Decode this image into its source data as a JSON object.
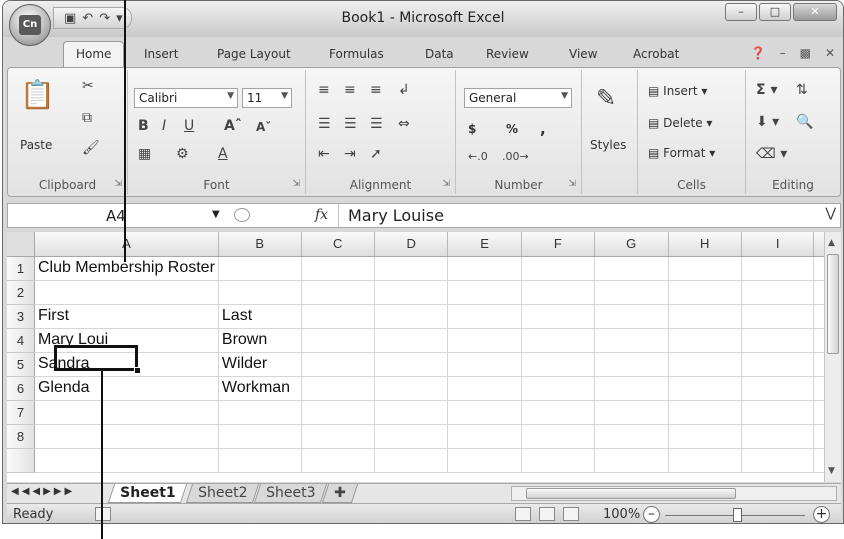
{
  "window": {
    "title": "Book1 - Microsoft Excel",
    "office_logo": "Cn"
  },
  "quick_access": [
    "save-icon",
    "undo-icon",
    "redo-icon",
    "customize-icon"
  ],
  "tabs": [
    "Home",
    "Insert",
    "Page Layout",
    "Formulas",
    "Data",
    "Review",
    "View",
    "Acrobat"
  ],
  "ribbon": {
    "clipboard": {
      "label": "Clipboard",
      "paste": "Paste"
    },
    "font": {
      "label": "Font",
      "name": "Calibri",
      "size": "11"
    },
    "alignment": {
      "label": "Alignment"
    },
    "number": {
      "label": "Number",
      "format": "General",
      "currency": "$",
      "percent": "%",
      "comma": ","
    },
    "styles": {
      "label": "Styles"
    },
    "cells": {
      "label": "Cells",
      "insert": "Insert",
      "delete": "Delete",
      "format": "Format"
    },
    "editing": {
      "label": "Editing"
    }
  },
  "formula_bar": {
    "name_box": "A4",
    "fx": "fx",
    "content": "Mary Louise"
  },
  "grid": {
    "columns": [
      "A",
      "B",
      "C",
      "D",
      "E",
      "F",
      "G",
      "H",
      "I"
    ],
    "rows": [
      {
        "num": "1",
        "a": "Club Membership Roster",
        "b": ""
      },
      {
        "num": "2",
        "a": "",
        "b": ""
      },
      {
        "num": "3",
        "a": "First",
        "b": "Last"
      },
      {
        "num": "4",
        "a": "Mary Loui",
        "b": "Brown"
      },
      {
        "num": "5",
        "a": "Sandra",
        "b": "Wilder"
      },
      {
        "num": "6",
        "a": "Glenda",
        "b": "Workman"
      },
      {
        "num": "7",
        "a": "",
        "b": ""
      },
      {
        "num": "8",
        "a": "",
        "b": ""
      }
    ]
  },
  "sheets": [
    "Sheet1",
    "Sheet2",
    "Sheet3"
  ],
  "status": {
    "ready": "Ready",
    "zoom": "100%"
  }
}
